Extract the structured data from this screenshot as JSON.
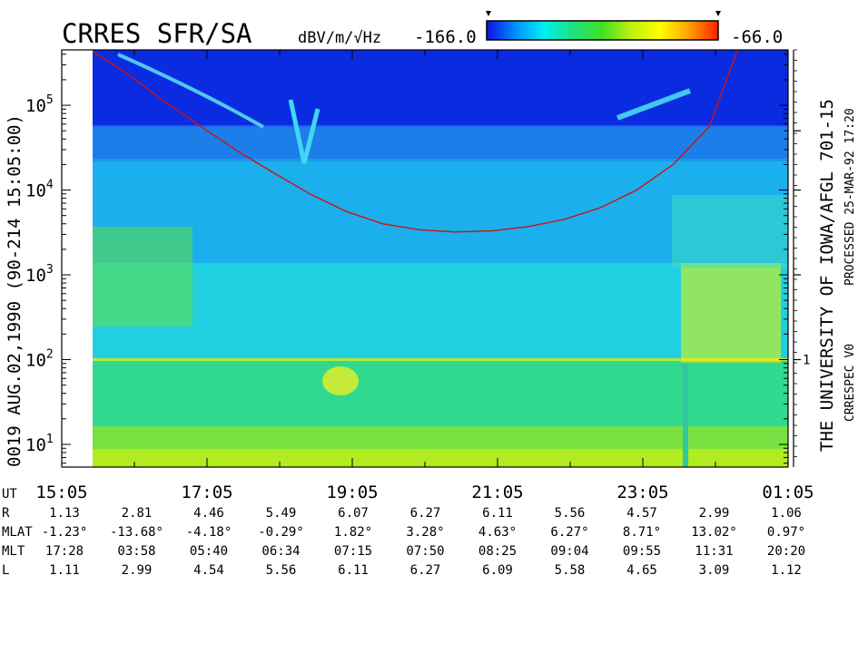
{
  "chart_data": {
    "type": "heatmap",
    "title": "CRRES SFR/SA",
    "units": "dBV/m/√Hz",
    "colorbar": {
      "min_label": "-166.0",
      "max_label": "-66.0",
      "min": -166.0,
      "max": -66.0,
      "colors": [
        "#1010e0",
        "#0090ff",
        "#00f0f0",
        "#20e080",
        "#40e020",
        "#c0f010",
        "#ffff00",
        "#ffa000",
        "#ff2000"
      ]
    },
    "ylabel_left": "0019  AUG.02,1990  (90-214 15:05:00)",
    "ylabel_right": "THE UNIVERSITY OF IOWA/AFGL  701-15",
    "right_note_1": "PROCESSED 25-MAR-92  17:20",
    "right_note_2": "CRRESPEC V0",
    "y_axis": {
      "scale": "log",
      "range_hz": [
        5.4,
        450000
      ],
      "tick_labels": [
        {
          "base": "10",
          "exp": "1",
          "value": 10
        },
        {
          "base": "10",
          "exp": "2",
          "value": 100
        },
        {
          "base": "10",
          "exp": "3",
          "value": 1000
        },
        {
          "base": "10",
          "exp": "4",
          "value": 10000
        },
        {
          "base": "10",
          "exp": "5",
          "value": 100000
        }
      ]
    },
    "right_axis": {
      "ticks": [
        {
          "label": "1",
          "value": 100
        },
        {
          "label": "",
          "value": 1000
        },
        {
          "label": "",
          "value": 10000
        },
        {
          "label": "",
          "value": 50000
        }
      ]
    },
    "x_axis": {
      "range_hours": [
        15.0833,
        25.0833
      ],
      "tick_labels": [
        {
          "label": "15:05",
          "hour": 15.0833
        },
        {
          "label": "17:05",
          "hour": 17.0833
        },
        {
          "label": "19:05",
          "hour": 19.0833
        },
        {
          "label": "21:05",
          "hour": 21.0833
        },
        {
          "label": "23:05",
          "hour": 23.0833
        },
        {
          "label": "01:05",
          "hour": 25.0833
        }
      ]
    },
    "ephemeris": {
      "ut_label": "UT",
      "rows": [
        {
          "label": "R",
          "values": [
            "1.13",
            "2.81",
            "4.46",
            "5.49",
            "6.07",
            "6.27",
            "6.11",
            "5.56",
            "4.57",
            "2.99",
            "1.06"
          ]
        },
        {
          "label": "MLAT",
          "values": [
            "-1.23°",
            "-13.68°",
            "-4.18°",
            "-0.29°",
            "1.82°",
            "3.28°",
            "4.63°",
            "6.27°",
            "8.71°",
            "13.02°",
            "0.97°"
          ]
        },
        {
          "label": "MLT",
          "values": [
            "17:28",
            "03:58",
            "05:40",
            "06:34",
            "07:15",
            "07:50",
            "08:25",
            "09:04",
            "09:55",
            "11:31",
            "20:20"
          ]
        },
        {
          "label": "L",
          "values": [
            "1.11",
            "2.99",
            "4.54",
            "5.56",
            "6.11",
            "6.27",
            "6.09",
            "5.58",
            "4.65",
            "3.09",
            "1.12"
          ]
        }
      ]
    },
    "electron_cyclotron_curve": {
      "color": "#d01010",
      "hours": [
        15.43,
        16.0,
        16.5,
        17.0,
        17.5,
        18.0,
        18.5,
        19.0,
        19.5,
        20.0,
        20.5,
        21.0,
        21.5,
        22.0,
        22.5,
        23.0,
        23.5,
        24.0,
        24.4
      ],
      "freq_hz": [
        480000,
        230000,
        110000,
        56000,
        29000,
        16000,
        9000,
        5600,
        4000,
        3400,
        3200,
        3300,
        3700,
        4500,
        6200,
        10000,
        20000,
        56000,
        480000
      ]
    }
  }
}
